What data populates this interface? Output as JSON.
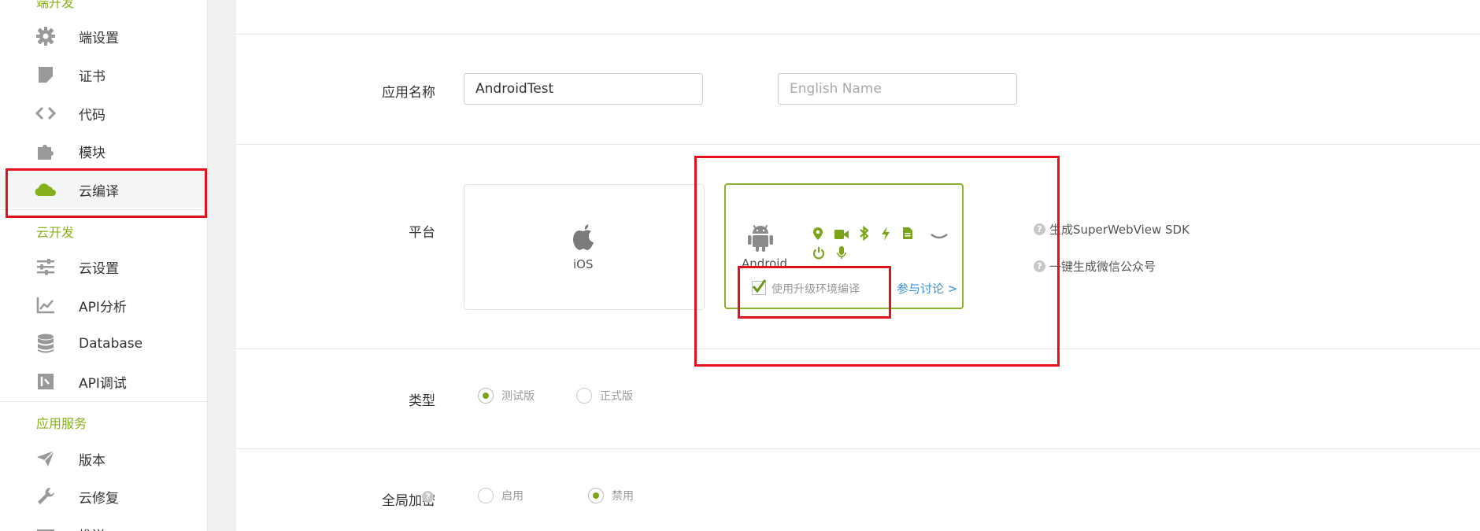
{
  "sidebar": {
    "sections": [
      {
        "title": "端开发"
      },
      {
        "title": "云开发"
      },
      {
        "title": "应用服务"
      }
    ],
    "items": [
      {
        "label": "端设置",
        "icon": "gear-icon"
      },
      {
        "label": "证书",
        "icon": "certificate-icon"
      },
      {
        "label": "代码",
        "icon": "code-icon"
      },
      {
        "label": "模块",
        "icon": "puzzle-icon"
      },
      {
        "label": "云编译",
        "icon": "cloud-icon"
      },
      {
        "label": "云设置",
        "icon": "sliders-icon"
      },
      {
        "label": "API分析",
        "icon": "chart-line-icon"
      },
      {
        "label": "Database",
        "icon": "database-icon"
      },
      {
        "label": "API调试",
        "icon": "debug-icon"
      },
      {
        "label": "版本",
        "icon": "rocket-icon"
      },
      {
        "label": "云修复",
        "icon": "wrench-icon"
      },
      {
        "label": "推送",
        "icon": "push-icon"
      }
    ],
    "active_color": "#85b21a"
  },
  "form": {
    "app_name_label": "应用名称",
    "app_name_value": "AndroidTest",
    "english_name_placeholder": "English Name",
    "platform_label": "平台",
    "ios_label": "iOS",
    "android_label": "Android",
    "upgrade_env_label": "使用升级环境编译",
    "discuss_link": "参与讨论 >",
    "help_sdk": "生成SuperWebView SDK",
    "help_wechat": "一键生成微信公众号",
    "type_label": "类型",
    "type_test": "测试版",
    "type_release": "正式版",
    "encrypt_label": "全局加密",
    "encrypt_on": "启用",
    "encrypt_off": "禁用"
  },
  "colors": {
    "accent": "#85b21a",
    "highlight": "#e3111b",
    "link": "#3b8de0"
  }
}
